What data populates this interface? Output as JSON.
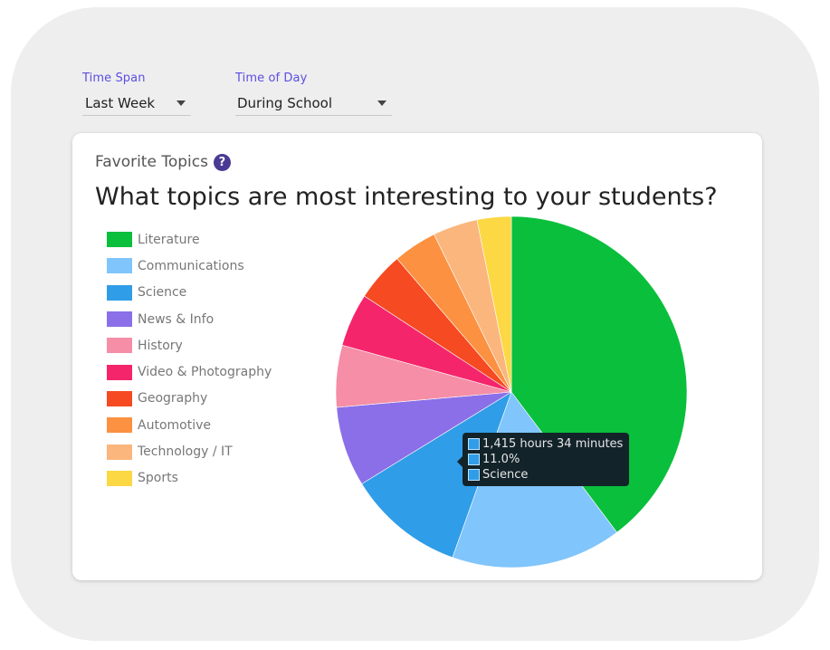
{
  "filters": {
    "time_span": {
      "label": "Time Span",
      "value": "Last Week"
    },
    "time_of_day": {
      "label": "Time of Day",
      "value": "During School"
    }
  },
  "card": {
    "title": "Favorite Topics",
    "question": "What topics are most interesting to your students?"
  },
  "icons": {
    "help": "question-circle-icon",
    "dropdown": "caret-down-icon"
  },
  "chart_data": {
    "type": "pie",
    "title": "",
    "legend_position": "left",
    "start_angle_deg": 0,
    "direction": "clockwise",
    "categories": [
      "Literature",
      "Communications",
      "Science",
      "News & Info",
      "History",
      "Video & Photography",
      "Geography",
      "Automotive",
      "Technology / IT",
      "Sports"
    ],
    "values": [
      40.5,
      16.0,
      11.0,
      7.5,
      5.8,
      5.0,
      4.6,
      4.1,
      4.2,
      3.2
    ],
    "colors": [
      "#0abf3c",
      "#80c5fb",
      "#2f9de8",
      "#8a6fe8",
      "#f58ea6",
      "#f5256b",
      "#f64a22",
      "#fb9141",
      "#fbb67e",
      "#fbd844"
    ],
    "tooltip": {
      "value": "1,415 hours 34 minutes",
      "percent": "11.0%",
      "label": "Science"
    }
  }
}
